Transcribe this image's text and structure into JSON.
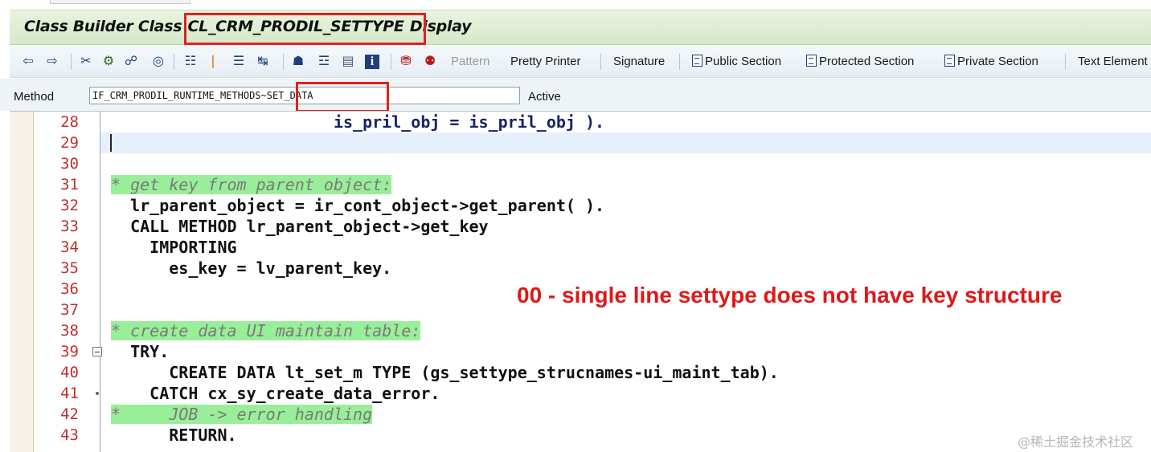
{
  "title": {
    "prefix": "Class Builder Class ",
    "class_name": "CL_CRM_PRODIL_SETTYPE",
    "suffix": " Display"
  },
  "toolbar": {
    "icons": [
      "back-icon",
      "forward-icon",
      "other-object-icon",
      "check-icon",
      "test-icon",
      "activate-icon",
      "where-used-icon",
      "edit-object-icon",
      "display-object-icon",
      "navigate-icon",
      "hierarchy-icon",
      "structure-icon",
      "window-icon",
      "info-icon",
      "local-types-icon",
      "macros-icon"
    ],
    "pattern": "Pattern",
    "pretty_printer": "Pretty Printer",
    "signature": "Signature",
    "public_section": "Public Section",
    "protected_section": "Protected Section",
    "private_section": "Private Section",
    "text_elements": "Text Element"
  },
  "method_bar": {
    "label": "Method",
    "value": "IF_CRM_PRODIL_RUNTIME_METHODS~SET_DATA",
    "status": "Active"
  },
  "code_lines": [
    {
      "n": "28",
      "text": "                       is_pril_obj = is_pril_obj )."
    },
    {
      "n": "29",
      "text": ""
    },
    {
      "n": "30",
      "text": ""
    },
    {
      "n": "31",
      "text": "* get key from parent object:"
    },
    {
      "n": "32",
      "text": "  lr_parent_object = ir_cont_object->get_parent( )."
    },
    {
      "n": "33",
      "text": "  CALL METHOD lr_parent_object->get_key"
    },
    {
      "n": "34",
      "text": "    IMPORTING"
    },
    {
      "n": "35",
      "text": "      es_key = lv_parent_key."
    },
    {
      "n": "36",
      "text": ""
    },
    {
      "n": "37",
      "text": ""
    },
    {
      "n": "38",
      "text": "* create data UI maintain table:"
    },
    {
      "n": "39",
      "text": "  TRY."
    },
    {
      "n": "40",
      "text": "      CREATE DATA lt_set_m TYPE (gs_settype_strucnames-ui_maint_tab)."
    },
    {
      "n": "41",
      "text": "    CATCH cx_sy_create_data_error."
    },
    {
      "n": "42",
      "text": "*     JOB -> error handling"
    },
    {
      "n": "43",
      "text": "      RETURN."
    }
  ],
  "annotation": "00 - single line settype does not have key structure",
  "watermark": "@稀土掘金技术社区",
  "colors": {
    "title_bar": "#d7e8c8",
    "comment_highlight": "#99ee99",
    "line_number": "#c03030",
    "keyword": "#8b1a4a",
    "annotation": "#e01818",
    "highlight_box": "#e02020"
  }
}
